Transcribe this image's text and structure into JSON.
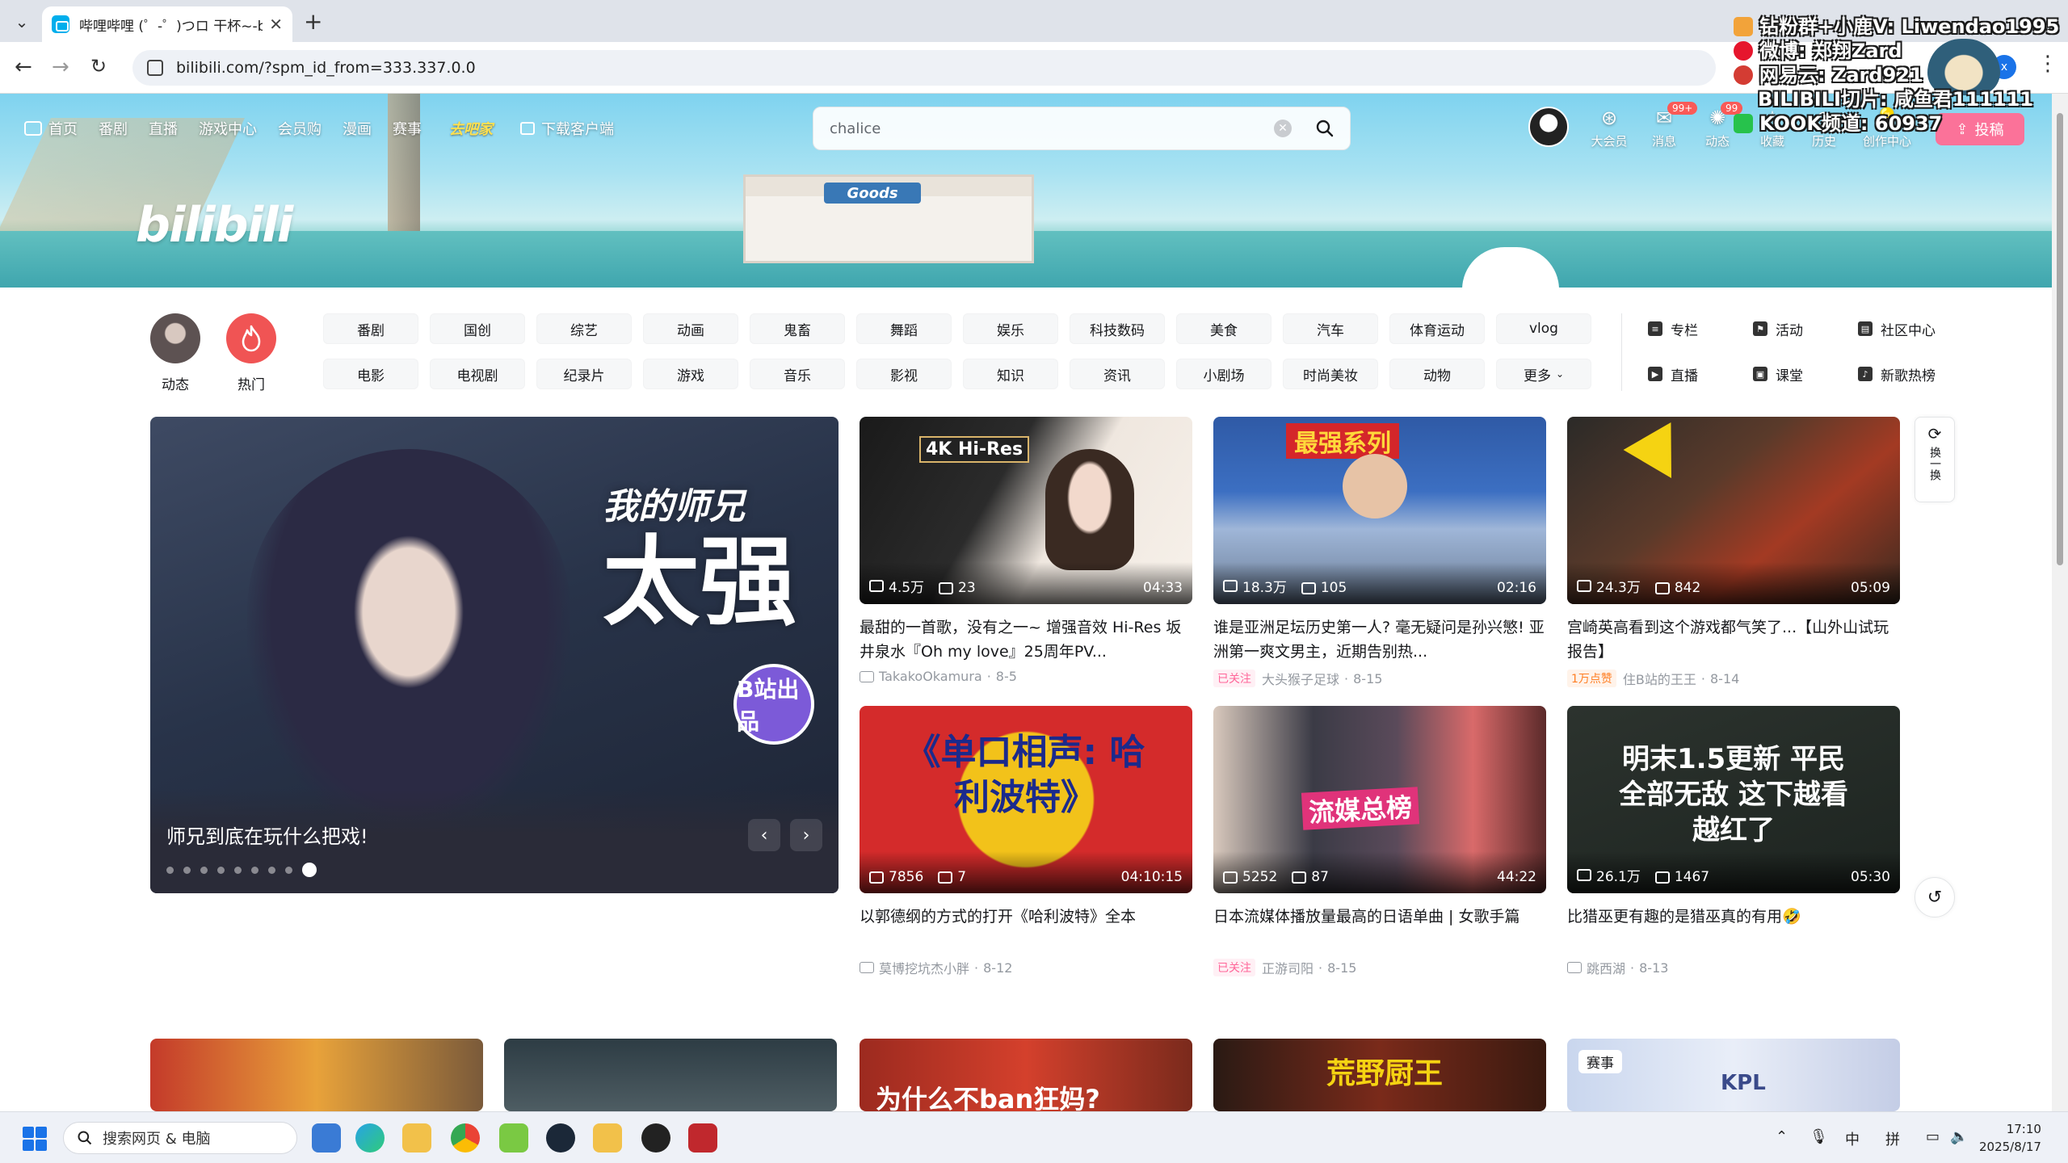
{
  "browser": {
    "tab_title": "哔哩哔哩 (゜-゜)つロ 干杯~-b",
    "url": "bilibili.com/?spm_id_from=333.337.0.0",
    "profile_initial": "x"
  },
  "overlay": {
    "lines": [
      "钻粉群+小鹿V: Liwendao1995",
      "微博: 郑翔Zard",
      "网易云: Zard921",
      "BILIBILI切片: 咸鱼君111111",
      "KOOK频道: 60937"
    ]
  },
  "header": {
    "nav": [
      "首页",
      "番剧",
      "直播",
      "游戏中心",
      "会员购",
      "漫画",
      "赛事"
    ],
    "doodle": "去吧家",
    "download": "下载客户端",
    "search_value": "chalice",
    "logo": "bilibili",
    "shop_sign": "Goods",
    "right_entries": [
      {
        "label": "大会员",
        "icon": "vip-icon"
      },
      {
        "label": "消息",
        "icon": "message-icon",
        "badge": "99+"
      },
      {
        "label": "动态",
        "icon": "dynamic-icon",
        "badge": "99"
      },
      {
        "label": "收藏",
        "icon": "favorite-icon"
      },
      {
        "label": "历史",
        "icon": "history-icon"
      },
      {
        "label": "创作中心",
        "icon": "creator-icon"
      }
    ],
    "upload": "投稿"
  },
  "quick": [
    {
      "label": "动态"
    },
    {
      "label": "热门"
    }
  ],
  "channels": [
    "番剧",
    "国创",
    "综艺",
    "动画",
    "鬼畜",
    "舞蹈",
    "娱乐",
    "科技数码",
    "美食",
    "汽车",
    "体育运动",
    "vlog",
    "电影",
    "电视剧",
    "纪录片",
    "游戏",
    "音乐",
    "影视",
    "知识",
    "资讯",
    "小剧场",
    "时尚美妆",
    "动物",
    "更多"
  ],
  "side_links": [
    "专栏",
    "活动",
    "社区中心",
    "直播",
    "课堂",
    "新歌热榜"
  ],
  "carousel": {
    "caption": "师兄到底在玩什么把戏!",
    "art_small": "我的师兄",
    "art_big": "太强",
    "badge": "B站出品",
    "dot_count": 9
  },
  "videos": [
    {
      "views": "4.5万",
      "danmaku": "23",
      "duration": "04:33",
      "title": "最甜的一首歌，没有之一~ 增强音效 Hi-Res 坂井泉水『Oh my love』25周年PV...",
      "up": "TakakoOkamura",
      "date": "8-5",
      "tag": "",
      "thumb_text": "4K Hi-Res"
    },
    {
      "views": "18.3万",
      "danmaku": "105",
      "duration": "02:16",
      "title": "谁是亚洲足坛历史第一人? 毫无疑问是孙兴慜! 亚洲第一爽文男主，近期告别热...",
      "up": "大头猴子足球",
      "date": "8-15",
      "tag": "已关注",
      "thumb_text": "最强系列"
    },
    {
      "views": "24.3万",
      "danmaku": "842",
      "duration": "05:09",
      "title": "宫崎英高看到这个游戏都气笑了...【山外山试玩报告】",
      "up": "住B站的王王",
      "date": "8-14",
      "tag": "1万点赞",
      "thumb_text": ""
    },
    {
      "views": "7856",
      "danmaku": "7",
      "duration": "04:10:15",
      "title": "以郭德纲的方式的打开《哈利波特》全本",
      "up": "莫博挖坑杰小胖",
      "date": "8-12",
      "tag": "",
      "thumb_text": "《单口相声: 哈利波特》"
    },
    {
      "views": "5252",
      "danmaku": "87",
      "duration": "44:22",
      "title": "日本流媒体播放量最高的日语单曲 | 女歌手篇",
      "up": "正游司阳",
      "date": "8-15",
      "tag": "已关注",
      "thumb_text": "流媒总榜"
    },
    {
      "views": "26.1万",
      "danmaku": "1467",
      "duration": "05:30",
      "title": "比猎巫更有趣的是猎巫真的有用🤣",
      "up": "跳西湖",
      "date": "8-13",
      "tag": "",
      "thumb_text": "明末1.5更新 平民全部无敌 这下越看越红了"
    }
  ],
  "bottom_row": [
    {
      "thumb_text": ""
    },
    {
      "thumb_text": ""
    },
    {
      "thumb_text": "为什么不ban狂妈?"
    },
    {
      "thumb_text": "荒野厨王"
    },
    {
      "thumb_text": "KPL",
      "badge": "赛事"
    }
  ],
  "float": {
    "refresh": "换一换"
  },
  "taskbar": {
    "search_placeholder": "搜索网页 & 电脑",
    "ime1": "中",
    "ime2": "拼",
    "time": "17:10",
    "date": "2025/8/17"
  },
  "colors": {
    "pink": "#fb7299",
    "blue": "#00aeec",
    "hot": "#f05454"
  }
}
